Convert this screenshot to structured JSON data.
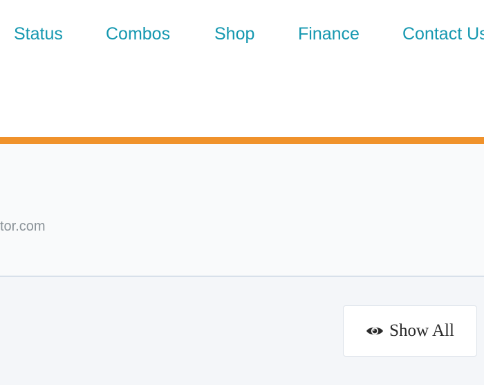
{
  "nav": {
    "items": [
      {
        "label": "Status"
      },
      {
        "label": "Combos"
      },
      {
        "label": "Shop"
      },
      {
        "label": "Finance"
      },
      {
        "label": "Contact Us"
      }
    ]
  },
  "info": {
    "domain_text": "tor.com"
  },
  "actions": {
    "show_all_label": "Show All",
    "show_all_icon": "eye-icon"
  },
  "colors": {
    "nav_link": "#1598b0",
    "accent_bar": "#f0922b",
    "muted_text": "#8a9298"
  }
}
